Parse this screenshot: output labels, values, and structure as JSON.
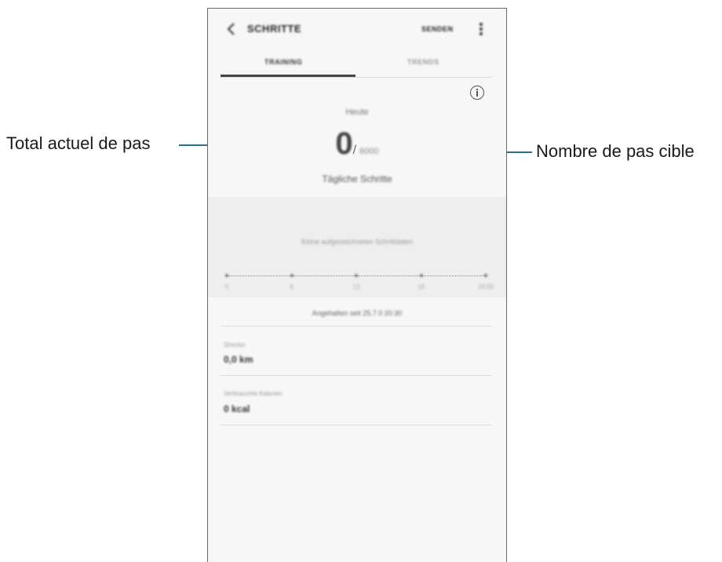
{
  "annotations": {
    "left": "Total actuel de pas",
    "right": "Nombre de pas cible"
  },
  "app": {
    "title": "SCHRITTE",
    "action": "SENDEN",
    "icons": {
      "back": "chevron-left-icon",
      "more": "more-vertical-icon",
      "info": "info-icon"
    }
  },
  "tabs": [
    {
      "label": "TRAINING",
      "active": true
    },
    {
      "label": "TRENDS",
      "active": false
    }
  ],
  "summary": {
    "day_label": "Heute",
    "current_steps": "0",
    "separator": "/",
    "target_steps": "6000",
    "caption": "Tägliche Schritte"
  },
  "chart": {
    "message": "Keine aufgezeichneten Schrittdaten",
    "tick_labels": [
      "0",
      "6",
      "12",
      "18",
      "24:00"
    ]
  },
  "recorded_since": "Angehalten seit 25.7.0 20:30",
  "metrics": [
    {
      "label": "Strecke",
      "value": "0,0 km"
    },
    {
      "label": "Verbrauchte Kalorien",
      "value": "0 kcal"
    }
  ],
  "colors": {
    "leader_line": "#2a6f8f",
    "phone_background": "#f7f7f7",
    "chart_background": "#eeeeee"
  }
}
